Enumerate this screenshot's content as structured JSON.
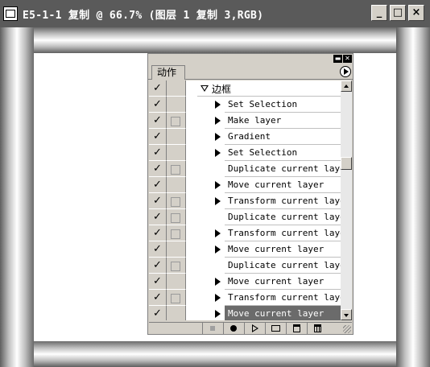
{
  "window": {
    "title": "E5-1-1 复制 @ 66.7% (图层 1 复制 3,RGB)",
    "minimize_label": "_",
    "maximize_label": "□",
    "close_label": "×"
  },
  "palette": {
    "tab_label": "动作",
    "set_name": "边框",
    "rows": [
      {
        "label": "Set Selection",
        "checked": true,
        "dialog": false,
        "expandable": true,
        "selected": false
      },
      {
        "label": "Make layer",
        "checked": true,
        "dialog": true,
        "expandable": true,
        "selected": false
      },
      {
        "label": "Gradient",
        "checked": true,
        "dialog": false,
        "expandable": true,
        "selected": false
      },
      {
        "label": "Set Selection",
        "checked": true,
        "dialog": false,
        "expandable": true,
        "selected": false
      },
      {
        "label": "Duplicate current layer",
        "checked": true,
        "dialog": true,
        "expandable": false,
        "selected": false
      },
      {
        "label": "Move current layer",
        "checked": true,
        "dialog": false,
        "expandable": true,
        "selected": false
      },
      {
        "label": "Transform current layer",
        "checked": true,
        "dialog": true,
        "expandable": true,
        "selected": false
      },
      {
        "label": "Duplicate current layer",
        "checked": true,
        "dialog": true,
        "expandable": false,
        "selected": false
      },
      {
        "label": "Transform current layer",
        "checked": true,
        "dialog": true,
        "expandable": true,
        "selected": false
      },
      {
        "label": "Move current layer",
        "checked": true,
        "dialog": false,
        "expandable": true,
        "selected": false
      },
      {
        "label": "Duplicate current layer",
        "checked": true,
        "dialog": true,
        "expandable": false,
        "selected": false
      },
      {
        "label": "Move current layer",
        "checked": true,
        "dialog": false,
        "expandable": true,
        "selected": false
      },
      {
        "label": "Transform current layer",
        "checked": true,
        "dialog": true,
        "expandable": true,
        "selected": false
      },
      {
        "label": "Move current layer",
        "checked": true,
        "dialog": false,
        "expandable": true,
        "selected": true
      }
    ],
    "check_glyph": "✓",
    "toolbar_icons": [
      "stop-icon",
      "record-icon",
      "play-icon",
      "new-set-icon",
      "new-action-icon",
      "delete-icon"
    ]
  }
}
